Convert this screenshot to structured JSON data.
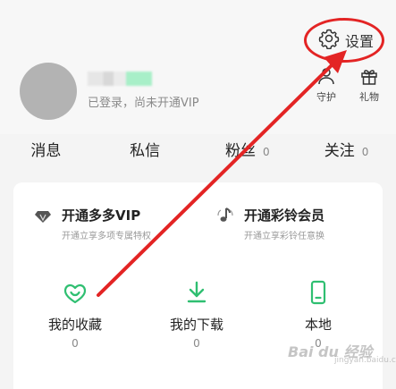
{
  "header": {
    "settings_label": "设置",
    "login_status": "已登录，尚未开通VIP",
    "quick_actions": [
      {
        "label": "守护",
        "icon": "shield-user-icon"
      },
      {
        "label": "礼物",
        "icon": "gift-icon"
      }
    ]
  },
  "stats": [
    {
      "label": "消息",
      "count": ""
    },
    {
      "label": "私信",
      "count": ""
    },
    {
      "label": "粉丝",
      "count": "0"
    },
    {
      "label": "关注",
      "count": "0"
    }
  ],
  "promos": [
    {
      "title": "开通多多VIP",
      "subtitle": "开通立享多项专属特权",
      "icon": "diamond-icon"
    },
    {
      "title": "开通彩铃会员",
      "subtitle": "开通立享彩铃任意换",
      "icon": "music-note-icon"
    }
  ],
  "tiles": [
    {
      "label": "我的收藏",
      "count": "0",
      "icon": "heart-smile-icon"
    },
    {
      "label": "我的下载",
      "count": "0",
      "icon": "download-icon"
    },
    {
      "label": "本地",
      "count": "0",
      "icon": "phone-icon"
    }
  ],
  "watermark": {
    "text": "Bai du 经验",
    "sub": "jingyan.baidu.com"
  },
  "colors": {
    "accent": "#2fbf71",
    "annotation": "#e32424"
  }
}
